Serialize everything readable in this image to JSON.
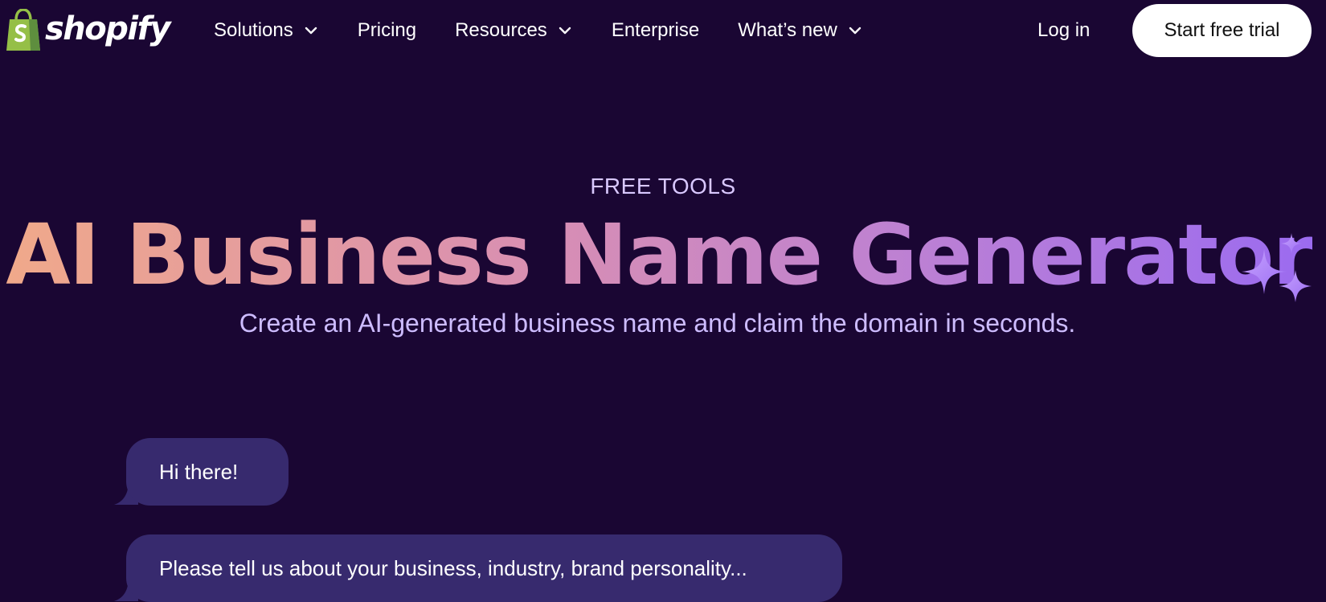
{
  "brand": {
    "name": "shopify",
    "bag_color": "#95bf47",
    "bag_dark": "#5e8e3e"
  },
  "nav": {
    "items": [
      {
        "label": "Solutions",
        "has_dropdown": true,
        "icon": "chevron-down-icon"
      },
      {
        "label": "Pricing",
        "has_dropdown": false
      },
      {
        "label": "Resources",
        "has_dropdown": true,
        "icon": "chevron-down-icon"
      },
      {
        "label": "Enterprise",
        "has_dropdown": false
      },
      {
        "label": "What’s new",
        "has_dropdown": true,
        "icon": "chevron-down-icon"
      }
    ],
    "login_label": "Log in",
    "cta_label": "Start free trial"
  },
  "hero": {
    "eyebrow": "FREE TOOLS",
    "title": "AI Business Name Generator",
    "subtitle": "Create an AI-generated business name and claim the domain in seconds.",
    "sparkle_icon": "sparkle-icon"
  },
  "chat": {
    "messages": [
      {
        "text": "Hi there!"
      },
      {
        "text": "Please tell us about your business, industry, brand personality..."
      }
    ]
  },
  "colors": {
    "background": "#1a0633",
    "bubble": "#372a6e",
    "eyebrow": "#d9c8ff",
    "subtitle": "#cdbcff",
    "gradient_start": "#f0a98a",
    "gradient_end": "#9b6bf0"
  }
}
